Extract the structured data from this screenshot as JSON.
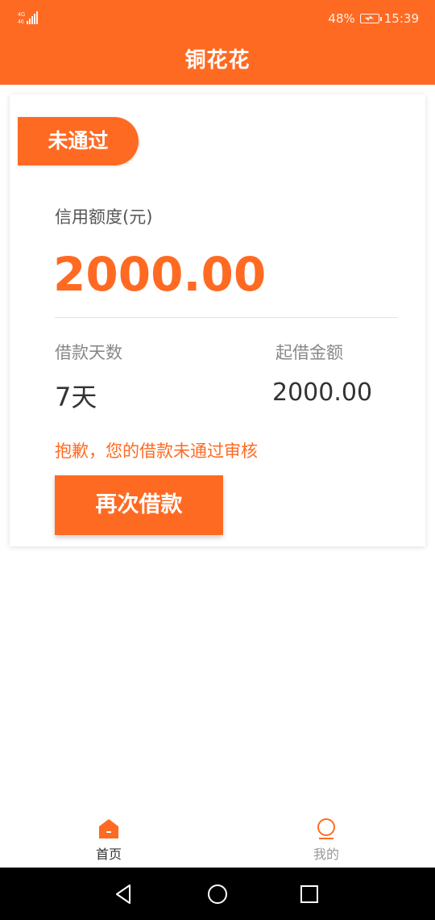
{
  "status_bar": {
    "network": "4G",
    "battery": "48%",
    "time": "15:39"
  },
  "header": {
    "title": "铜花花"
  },
  "card": {
    "status_tag": "未通过",
    "credit_label": "信用额度(元)",
    "credit_amount": "2000.00",
    "days_label": "借款天数",
    "days_value": "7天",
    "min_amount_label": "起借金额",
    "min_amount_value": "2000.00",
    "reject_message": "抱歉，您的借款未通过审核",
    "retry_button": "再次借款"
  },
  "tabbar": {
    "items": [
      {
        "label": "首页",
        "icon": "home-icon",
        "active": true
      },
      {
        "label": "我的",
        "icon": "profile-icon",
        "active": false
      }
    ]
  },
  "colors": {
    "brand": "#ff6a22",
    "background": "#ffffff",
    "navbar": "#000000"
  }
}
